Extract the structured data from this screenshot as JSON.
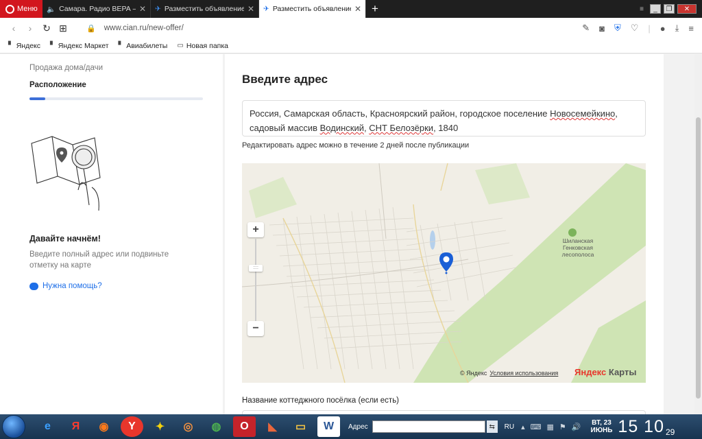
{
  "browser": {
    "menu_label": "Меню",
    "tabs": [
      {
        "title": "Самара. Радио ВЕРА —",
        "icon": "speaker-icon",
        "active": false
      },
      {
        "title": "Разместить объявление о",
        "icon": "cian-icon",
        "active": false
      },
      {
        "title": "Разместить объявление о",
        "icon": "cian-icon",
        "active": true
      }
    ],
    "new_tab": "+",
    "url": "www.cian.ru/new-offer/",
    "bookmarks": [
      "Яндекс",
      "Яндекс Маркет",
      "Авиабилеты",
      "Новая папка"
    ]
  },
  "sidebar": {
    "prev_step": "Продажа дома/дачи",
    "current_step": "Расположение",
    "progress": 0.09,
    "start_title": "Давайте начнём!",
    "start_text": "Введите полный адрес или подвиньте отметку на карте",
    "help_link": "Нужна помощь?"
  },
  "main": {
    "heading": "Введите адрес",
    "address_parts": {
      "p1": "Россия, Самарская область, Красноярский район, городское поселение ",
      "u1": "Новосемейкино",
      "p2": ",",
      "p3": "садовый массив ",
      "u2": "Водинский",
      "p4": ", ",
      "u3": "СНТ Белозёрки",
      "p5": ", 1840"
    },
    "address_note": "Редактировать адрес можно в течение 2 дней после публикации",
    "map": {
      "forest_label": "Шиланская Генковская лесополоса",
      "copyright": "© Яндекс",
      "terms_link": "Условия использования",
      "logo_ya": "Яндекс",
      "logo_rest": " Карты",
      "zoom_in": "+",
      "zoom_out": "−"
    },
    "village_label": "Название коттеджного посёлка (если есть)"
  },
  "taskbar": {
    "address_label": "Адрес",
    "lang": "RU",
    "date_line1": "ВТ, 23",
    "date_line2": "ИЮНЬ",
    "time": "15 10",
    "seconds": "29"
  },
  "colors": {
    "accent": "#1e6fe8",
    "opera_red": "#d2161e",
    "map_green": "#cfe4b4",
    "pin": "#1a5fd6"
  }
}
